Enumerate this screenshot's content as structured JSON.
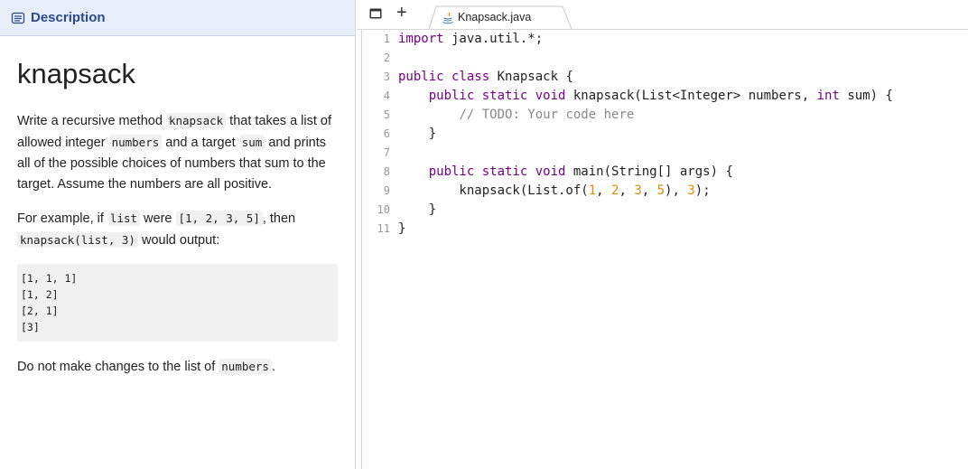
{
  "description": {
    "header": "Description",
    "title": "knapsack",
    "para1": [
      "Write a recursive method ",
      "knapsack",
      " that takes a list of allowed integer ",
      "numbers",
      " and a target ",
      "sum",
      " and prints all of the possible choices of numbers that sum to the target. Assume the numbers are all positive."
    ],
    "para2": [
      "For example, if ",
      "list",
      " were ",
      "[1, 2, 3, 5]",
      ", then ",
      "knapsack(list, 3)",
      " would output:"
    ],
    "output_lines": [
      "[1, 1, 1]",
      "[1, 2]",
      "[2, 1]",
      "[3]"
    ],
    "para3": [
      "Do not make changes to the list of ",
      "numbers",
      "."
    ]
  },
  "editor": {
    "add_tab": "+",
    "tab_label": "Knapsack.java",
    "line_numbers": [
      "1",
      "2",
      "3",
      "4",
      "5",
      "6",
      "7",
      "8",
      "9",
      "10",
      "11"
    ],
    "lines": [
      [
        [
          "kw",
          "import"
        ],
        [
          "tx",
          " java.util.*;"
        ]
      ],
      [],
      [
        [
          "kw",
          "public class"
        ],
        [
          "tx",
          " Knapsack {"
        ]
      ],
      [
        [
          "tx",
          "    "
        ],
        [
          "kw",
          "public static void"
        ],
        [
          "tx",
          " knapsack(List<Integer> numbers, "
        ],
        [
          "kw",
          "int"
        ],
        [
          "tx",
          " sum) {"
        ]
      ],
      [
        [
          "tx",
          "        "
        ],
        [
          "cm",
          "// TODO: Your code here"
        ]
      ],
      [
        [
          "tx",
          "    }"
        ]
      ],
      [],
      [
        [
          "tx",
          "    "
        ],
        [
          "kw",
          "public static void"
        ],
        [
          "tx",
          " main(String[] args) {"
        ]
      ],
      [
        [
          "tx",
          "        knapsack(List.of("
        ],
        [
          "nm",
          "1"
        ],
        [
          "tx",
          ", "
        ],
        [
          "nm",
          "2"
        ],
        [
          "tx",
          ", "
        ],
        [
          "nm",
          "3"
        ],
        [
          "tx",
          ", "
        ],
        [
          "nm",
          "5"
        ],
        [
          "tx",
          "), "
        ],
        [
          "nm",
          "3"
        ],
        [
          "tx",
          ");"
        ]
      ],
      [
        [
          "tx",
          "    }"
        ]
      ],
      [
        [
          "tx",
          "}"
        ]
      ]
    ]
  },
  "colors": {
    "keyword": "#770088",
    "comment": "#888888",
    "number": "#e08e00",
    "header_bg": "#e8eef9",
    "header_text": "#2b4a8a"
  }
}
